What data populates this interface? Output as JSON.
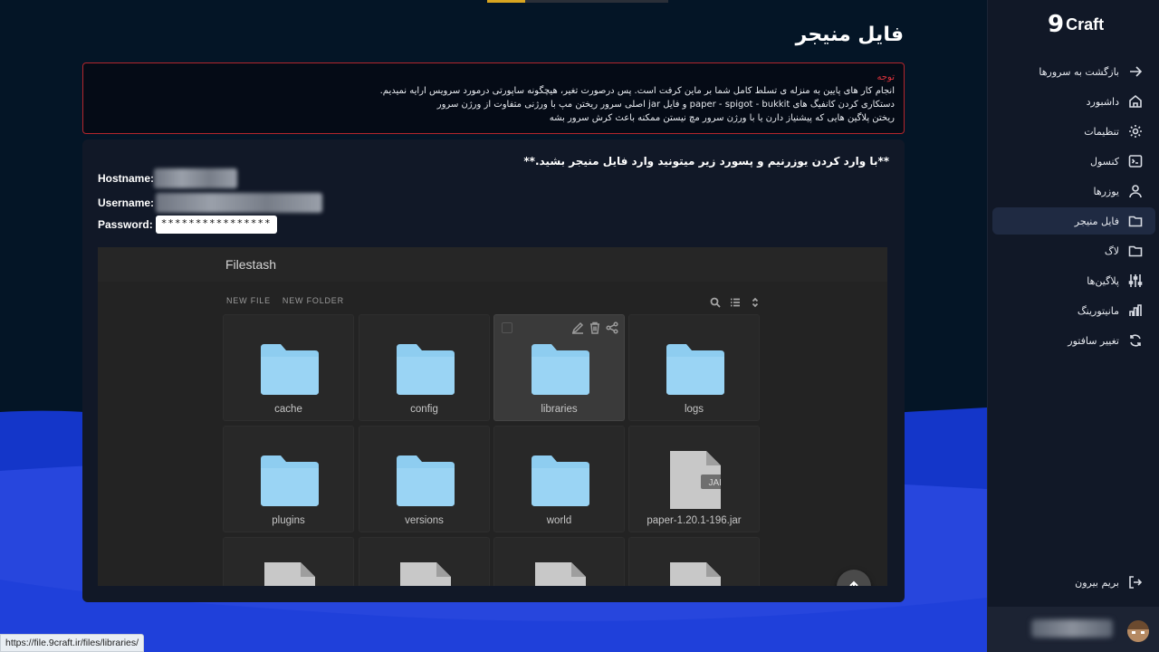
{
  "sidebar": {
    "logo_mark": "9",
    "logo_text": "Craft",
    "items": [
      {
        "label": "بازگشت به سرورها",
        "icon": "arrow-right-icon"
      },
      {
        "label": "داشبورد",
        "icon": "home-icon"
      },
      {
        "label": "تنظیمات",
        "icon": "gear-icon"
      },
      {
        "label": "کنسول",
        "icon": "terminal-icon"
      },
      {
        "label": "یوزرها",
        "icon": "users-icon"
      },
      {
        "label": "فایل منیجر",
        "icon": "folder-icon",
        "active": true
      },
      {
        "label": "لاگ",
        "icon": "folder-icon"
      },
      {
        "label": "پلاگین‌ها",
        "icon": "sliders-icon"
      },
      {
        "label": "مانیتورینگ",
        "icon": "bar-chart-icon"
      },
      {
        "label": "تغییر سافتور",
        "icon": "refresh-icon"
      }
    ],
    "logout_label": "بریم بیرون"
  },
  "main": {
    "page_title": "فایل منیجر",
    "notice": {
      "title": "توجه",
      "lines": [
        "انجام کار های پایین به منزله ی تسلط کامل شما بر ماین کرفت است. پس درصورت تغیر، هیچگونه ساپورتی درمورد سرویس ارایه نمیدیم.",
        "دستکاری کردن کانفیگ های paper - spigot - bukkit و فایل jar اصلی سرور ریختن مپ با ورژنی متفاوت از ورژن سرور",
        "ریختن پلاگین هایی که پیشنیاز دارن یا با ورژن سرور مچ نیستن ممکنه باعث کرش سرور بشه"
      ]
    },
    "credentials": {
      "heading": "**با وارد کردن یوزرنیم و پسورد زیر میتونید وارد فایل منیجر بشید.**",
      "hostname_label": "Hostname:",
      "username_label": "Username:",
      "password_label": "Password:",
      "password_value": "****************"
    }
  },
  "filestash": {
    "title": "Filestash",
    "new_file": "NEW FILE",
    "new_folder": "NEW FOLDER",
    "files": [
      {
        "name": "cache",
        "type": "folder"
      },
      {
        "name": "config",
        "type": "folder"
      },
      {
        "name": "libraries",
        "type": "folder",
        "hovered": true
      },
      {
        "name": "logs",
        "type": "folder"
      },
      {
        "name": "plugins",
        "type": "folder"
      },
      {
        "name": "versions",
        "type": "folder"
      },
      {
        "name": "world",
        "type": "folder"
      },
      {
        "name": "paper-1.20.1-196.jar",
        "type": "file",
        "badge": "JAR"
      },
      {
        "name": "",
        "type": "file"
      },
      {
        "name": "",
        "type": "file"
      },
      {
        "name": "",
        "type": "file"
      },
      {
        "name": "",
        "type": "file"
      }
    ]
  },
  "status_bar": {
    "url": "https://file.9craft.ir/files/libraries/"
  },
  "colors": {
    "accent_red": "#e0333d",
    "folder_blue": "#8ecdf0",
    "sidebar_bg": "#111827",
    "wave_blue": "#1a3dd6"
  }
}
